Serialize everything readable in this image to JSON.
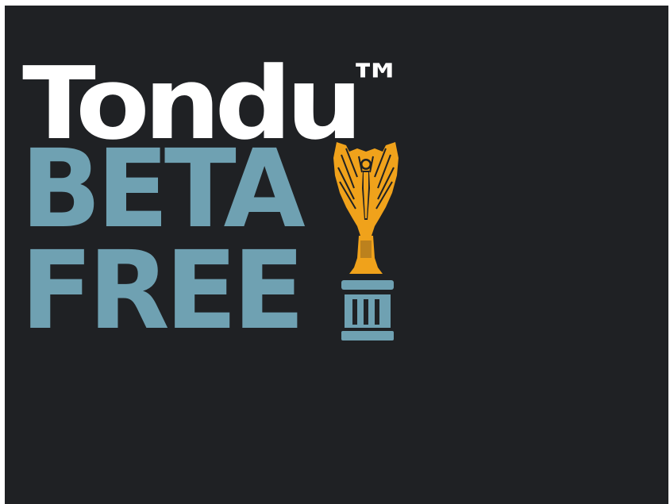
{
  "logo": {
    "name": "Tondu",
    "trademark": "™",
    "line2": "BETA",
    "line3": "FREE"
  },
  "icons": {
    "trophy": "world-cup-trophy-icon"
  },
  "colors": {
    "background": "#1f2124",
    "title": "#ffffff",
    "accent_blue": "#6fa1b2",
    "trophy": "#f0a21b"
  }
}
